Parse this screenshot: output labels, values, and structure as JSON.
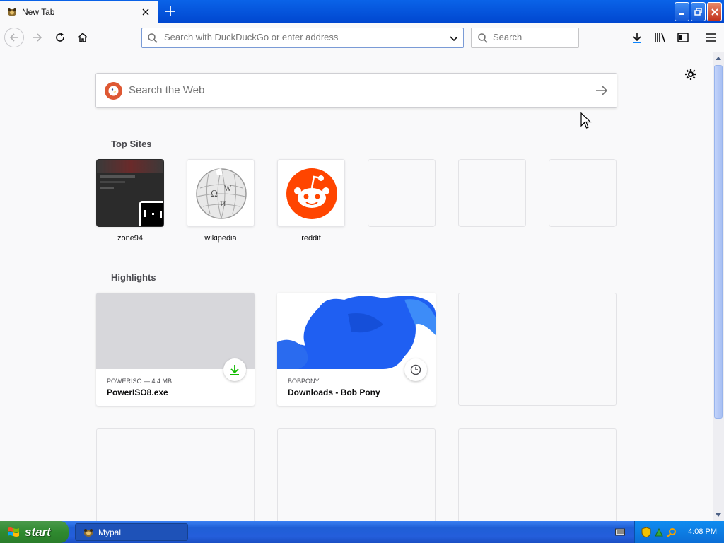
{
  "browser": {
    "tab_title": "New Tab",
    "url_placeholder": "Search with DuckDuckGo or enter address",
    "search_placeholder": "Search"
  },
  "content": {
    "websearch_placeholder": "Search the Web",
    "top_sites_title": "Top Sites",
    "top_sites": [
      {
        "label": "zone94"
      },
      {
        "label": "wikipedia"
      },
      {
        "label": "reddit"
      }
    ],
    "highlights_title": "Highlights",
    "highlights": [
      {
        "meta": "POWERISO — 4.4 MB",
        "name": "PowerISO8.exe",
        "badge": "download-icon"
      },
      {
        "meta": "BOBPONY",
        "name": "Downloads - Bob Pony",
        "badge": "clock-icon"
      }
    ]
  },
  "taskbar": {
    "start_label": "start",
    "task_label": "Mypal",
    "clock": "4:08 PM"
  },
  "colors": {
    "accent": "#0a84ff",
    "reddit": "#ff4500",
    "download_green": "#12bc00"
  }
}
